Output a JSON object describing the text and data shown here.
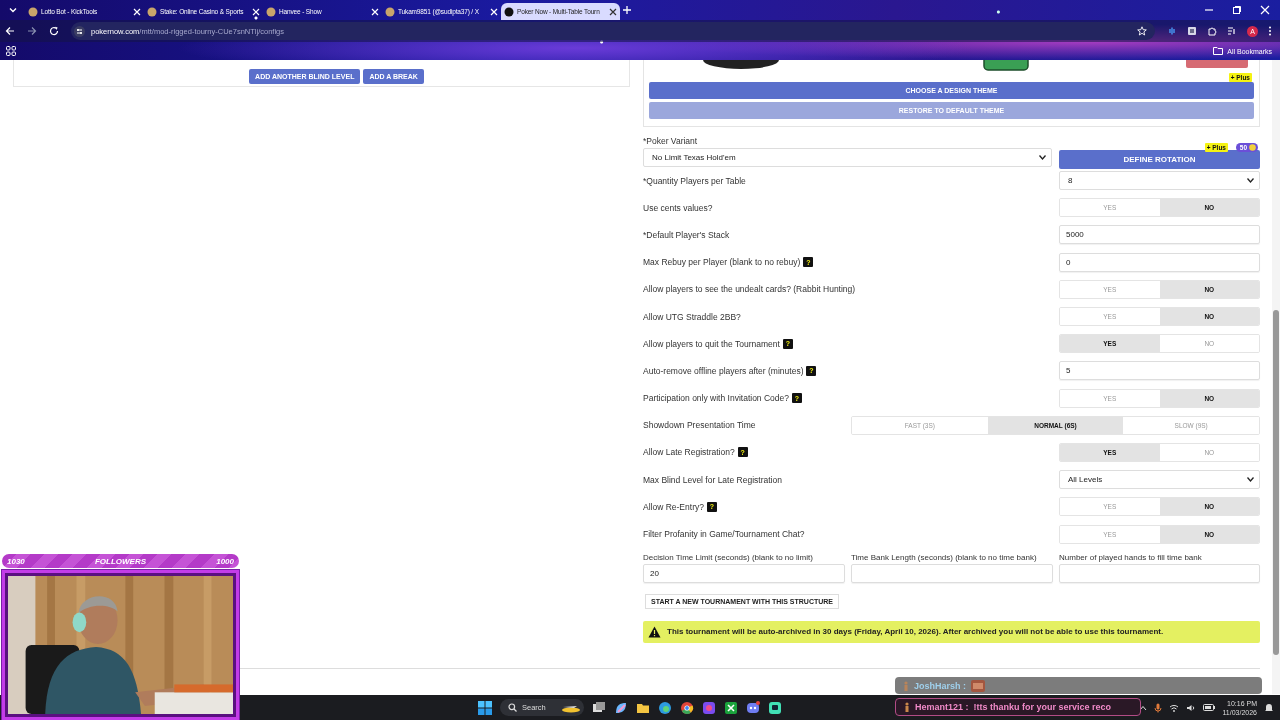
{
  "browser": {
    "tabs": [
      {
        "title": "Lotto Bot - KickTools",
        "selected": false
      },
      {
        "title": "Stake: Online Casino & Sports",
        "selected": false
      },
      {
        "title": "Hanvee - Show",
        "selected": false
      },
      {
        "title": "Tukam9851 (@sudipta37) / X",
        "selected": false
      },
      {
        "title": "Poker Now - Multi-Table Tourn",
        "selected": true
      }
    ],
    "url_host": "pokernow.com",
    "url_path": "/mtt/mod-rigged-tourny-CUe7snNTlj/configs",
    "profile_initial": "A",
    "bookmarks_label": "All Bookmarks"
  },
  "blind_actions": [
    "ADD ANOTHER BLIND LEVEL",
    "ADD A BREAK"
  ],
  "theme": {
    "choose_button": "CHOOSE A DESIGN THEME",
    "restore_button": "RESTORE TO DEFAULT THEME",
    "plus_badge": "+ Plus"
  },
  "variant": {
    "label": "*Poker Variant",
    "value": "No Limit Texas Hold'em",
    "rotation_button": "DEFINE ROTATION",
    "plus_badge": "+ Plus",
    "coin_count": "50"
  },
  "settings": [
    {
      "kind": "select",
      "label": "*Quantity Players per Table",
      "value": "8"
    },
    {
      "kind": "toggle",
      "label": "Use cents values?",
      "options": [
        {
          "label": "YES",
          "selected": false
        },
        {
          "label": "NO",
          "selected": true
        }
      ]
    },
    {
      "kind": "input",
      "label": "*Default Player's Stack",
      "value": "5000"
    },
    {
      "kind": "input",
      "label": "Max Rebuy per Player (blank to no rebuy)",
      "help": "?",
      "value": "0"
    },
    {
      "kind": "toggle",
      "label": "Allow players to see the undealt cards? (Rabbit Hunting)",
      "options": [
        {
          "label": "YES",
          "selected": false
        },
        {
          "label": "NO",
          "selected": true
        }
      ]
    },
    {
      "kind": "toggle",
      "label": "Allow UTG Straddle 2BB?",
      "options": [
        {
          "label": "YES",
          "selected": false
        },
        {
          "label": "NO",
          "selected": true
        }
      ]
    },
    {
      "kind": "toggle",
      "label": "Allow players to quit the Tournament",
      "help": "?",
      "options": [
        {
          "label": "YES",
          "selected": true
        },
        {
          "label": "NO",
          "selected": false
        }
      ]
    },
    {
      "kind": "input",
      "label": "Auto-remove offline players after (minutes)",
      "help": "?",
      "value": "5"
    },
    {
      "kind": "toggle",
      "label": "Participation only with Invitation Code?",
      "help": "?",
      "options": [
        {
          "label": "YES",
          "selected": false
        },
        {
          "label": "NO",
          "selected": true
        }
      ]
    },
    {
      "kind": "wide_toggle",
      "label": "Showdown Presentation Time",
      "options": [
        {
          "label": "FAST (3S)",
          "selected": false
        },
        {
          "label": "NORMAL (6S)",
          "selected": true
        },
        {
          "label": "SLOW (9S)",
          "selected": false
        }
      ]
    },
    {
      "kind": "toggle",
      "label": "Allow Late Registration?",
      "help": "?",
      "options": [
        {
          "label": "YES",
          "selected": true
        },
        {
          "label": "NO",
          "selected": false
        }
      ]
    },
    {
      "kind": "select",
      "label": "Max Blind Level for Late Registration",
      "value": "All Levels"
    },
    {
      "kind": "toggle",
      "label": "Allow Re-Entry?",
      "help": "?",
      "options": [
        {
          "label": "YES",
          "selected": false
        },
        {
          "label": "NO",
          "selected": true
        }
      ]
    },
    {
      "kind": "toggle",
      "label": "Filter Profanity in Game/Tournament Chat?",
      "options": [
        {
          "label": "YES",
          "selected": false
        },
        {
          "label": "NO",
          "selected": true
        }
      ]
    }
  ],
  "timing": [
    {
      "label": "Decision Time Limit (seconds) (blank to no limit)",
      "value": "20"
    },
    {
      "label": "Time Bank Length (seconds) (blank to no time bank)"
    },
    {
      "label": "Number of played hands to fill time bank"
    }
  ],
  "start_button": "START A NEW TOURNAMENT WITH THIS STRUCTURE",
  "warning": "This tournament will be auto-archived in 30 days (Friday, April 10, 2026). After archived you will not be able to use this tournament.",
  "stream": {
    "followers": {
      "current": "1030",
      "title": "FOLLOWERS",
      "goal": "1000"
    },
    "chat": [
      {
        "user": "JoshHarsh :"
      },
      {
        "user": "Hemant121 :",
        "message": "!tts thanku for your service reco"
      }
    ]
  },
  "taskbar": {
    "search_placeholder": "Search",
    "time": "10:16 PM",
    "date": "11/03/2026"
  }
}
